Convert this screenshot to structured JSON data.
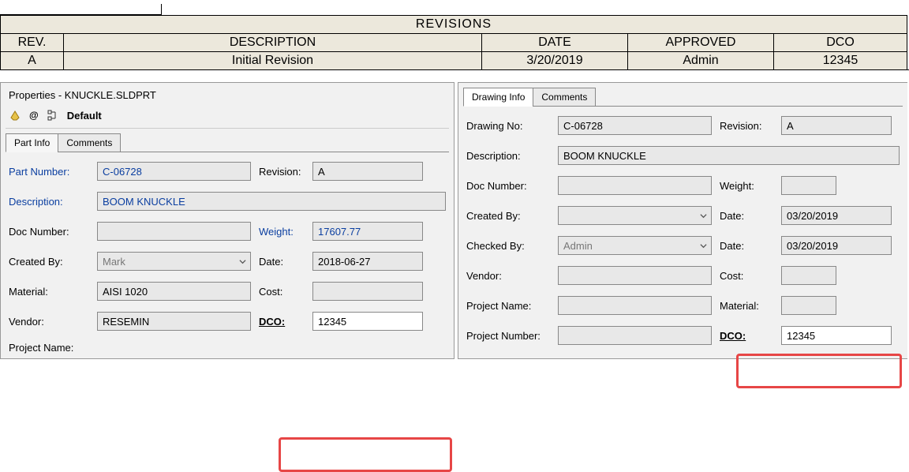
{
  "revisions": {
    "title": "REVISIONS",
    "headers": {
      "rev": "REV.",
      "description": "DESCRIPTION",
      "date": "DATE",
      "approved": "APPROVED",
      "dco": "DCO"
    },
    "rows": [
      {
        "rev": "A",
        "description": "Initial Revision",
        "date": "3/20/2019",
        "approved": "Admin",
        "dco": "12345"
      }
    ]
  },
  "leftPanel": {
    "title": "Properties - KNUCKLE.SLDPRT",
    "config": {
      "at": "@",
      "name": "Default"
    },
    "tabs": {
      "partInfo": "Part Info",
      "comments": "Comments"
    },
    "labels": {
      "partNumber": "Part Number:",
      "revision": "Revision:",
      "description": "Description:",
      "docNumber": "Doc Number:",
      "weight": "Weight:",
      "createdBy": "Created By:",
      "date": "Date:",
      "material": "Material:",
      "cost": "Cost:",
      "vendor": "Vendor:",
      "dco": "DCO:",
      "projectName": "Project Name:"
    },
    "values": {
      "partNumber": "C-06728",
      "revision": "A",
      "description": "BOOM KNUCKLE",
      "docNumber": "",
      "weight": "17607.77",
      "createdBy": "Mark",
      "date": "2018-06-27",
      "material": "AISI 1020",
      "cost": "",
      "vendor": "RESEMIN",
      "dco": "12345"
    }
  },
  "rightPanel": {
    "tabs": {
      "drawingInfo": "Drawing Info",
      "comments": "Comments"
    },
    "labels": {
      "drawingNo": "Drawing No:",
      "revision": "Revision:",
      "description": "Description:",
      "docNumber": "Doc Number:",
      "weight": "Weight:",
      "createdBy": "Created By:",
      "date": "Date:",
      "checkedBy": "Checked By:",
      "vendor": "Vendor:",
      "cost": "Cost:",
      "projectName": "Project Name:",
      "material": "Material:",
      "projectNumber": "Project Number:",
      "dco": "DCO:"
    },
    "values": {
      "drawingNo": "C-06728",
      "revision": "A",
      "description": "BOOM KNUCKLE",
      "docNumber": "",
      "weight": "",
      "createdBy": "",
      "createdDate": "03/20/2019",
      "checkedBy": "Admin",
      "checkedDate": "03/20/2019",
      "vendor": "",
      "cost": "",
      "projectName": "",
      "material": "",
      "projectNumber": "",
      "dco": "12345"
    }
  }
}
